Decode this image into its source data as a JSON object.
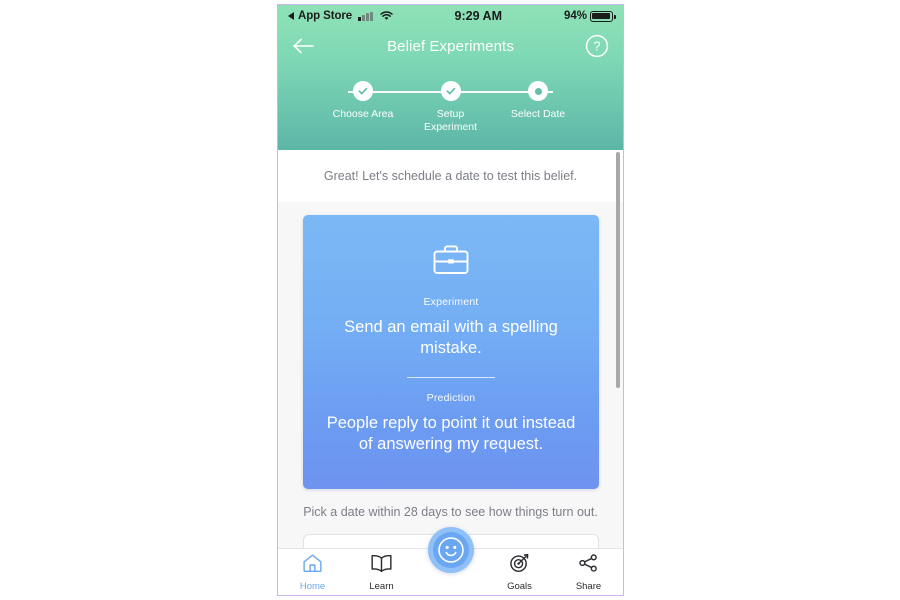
{
  "status_bar": {
    "back_label": "App Store",
    "back_icon": "triangle-left-icon",
    "signal_icon": "cellular-bars-icon",
    "wifi_icon": "wifi-icon",
    "time": "9:29 AM",
    "battery_percent": "94%",
    "battery_icon": "battery-icon"
  },
  "header": {
    "title": "Belief Experiments",
    "back_icon": "arrow-left-icon",
    "help_icon": "question-circle-icon",
    "gradient_from": "#8fe2b6",
    "gradient_to": "#5db6a6",
    "steps": [
      {
        "label": "Choose Area",
        "state": "completed",
        "icon": "check-icon"
      },
      {
        "label": "Setup Experiment",
        "state": "completed",
        "icon": "check-icon"
      },
      {
        "label": "Select Date",
        "state": "current",
        "icon": "dot-icon"
      }
    ]
  },
  "main": {
    "intro_text": "Great! Let's schedule a date to test this belief.",
    "card": {
      "icon": "briefcase-icon",
      "experiment_kicker": "Experiment",
      "experiment_text": "Send an email with a spelling mistake.",
      "prediction_kicker": "Prediction",
      "prediction_text": "People reply to point it out instead of answering my request.",
      "accent_color": "#6e9cf2"
    },
    "hint_text": "Pick a date within 28 days to see how things turn out.",
    "date_field_value": "",
    "date_field_placeholder": ""
  },
  "tabbar": {
    "items": [
      {
        "label": "Home",
        "icon": "home-icon",
        "active": true
      },
      {
        "label": "Learn",
        "icon": "book-icon",
        "active": false
      },
      {
        "label": "Goals",
        "icon": "target-icon",
        "active": false
      },
      {
        "label": "Share",
        "icon": "share-icon",
        "active": false
      }
    ],
    "fab_icon": "smiley-face-icon",
    "active_color": "#6ea8f0"
  }
}
